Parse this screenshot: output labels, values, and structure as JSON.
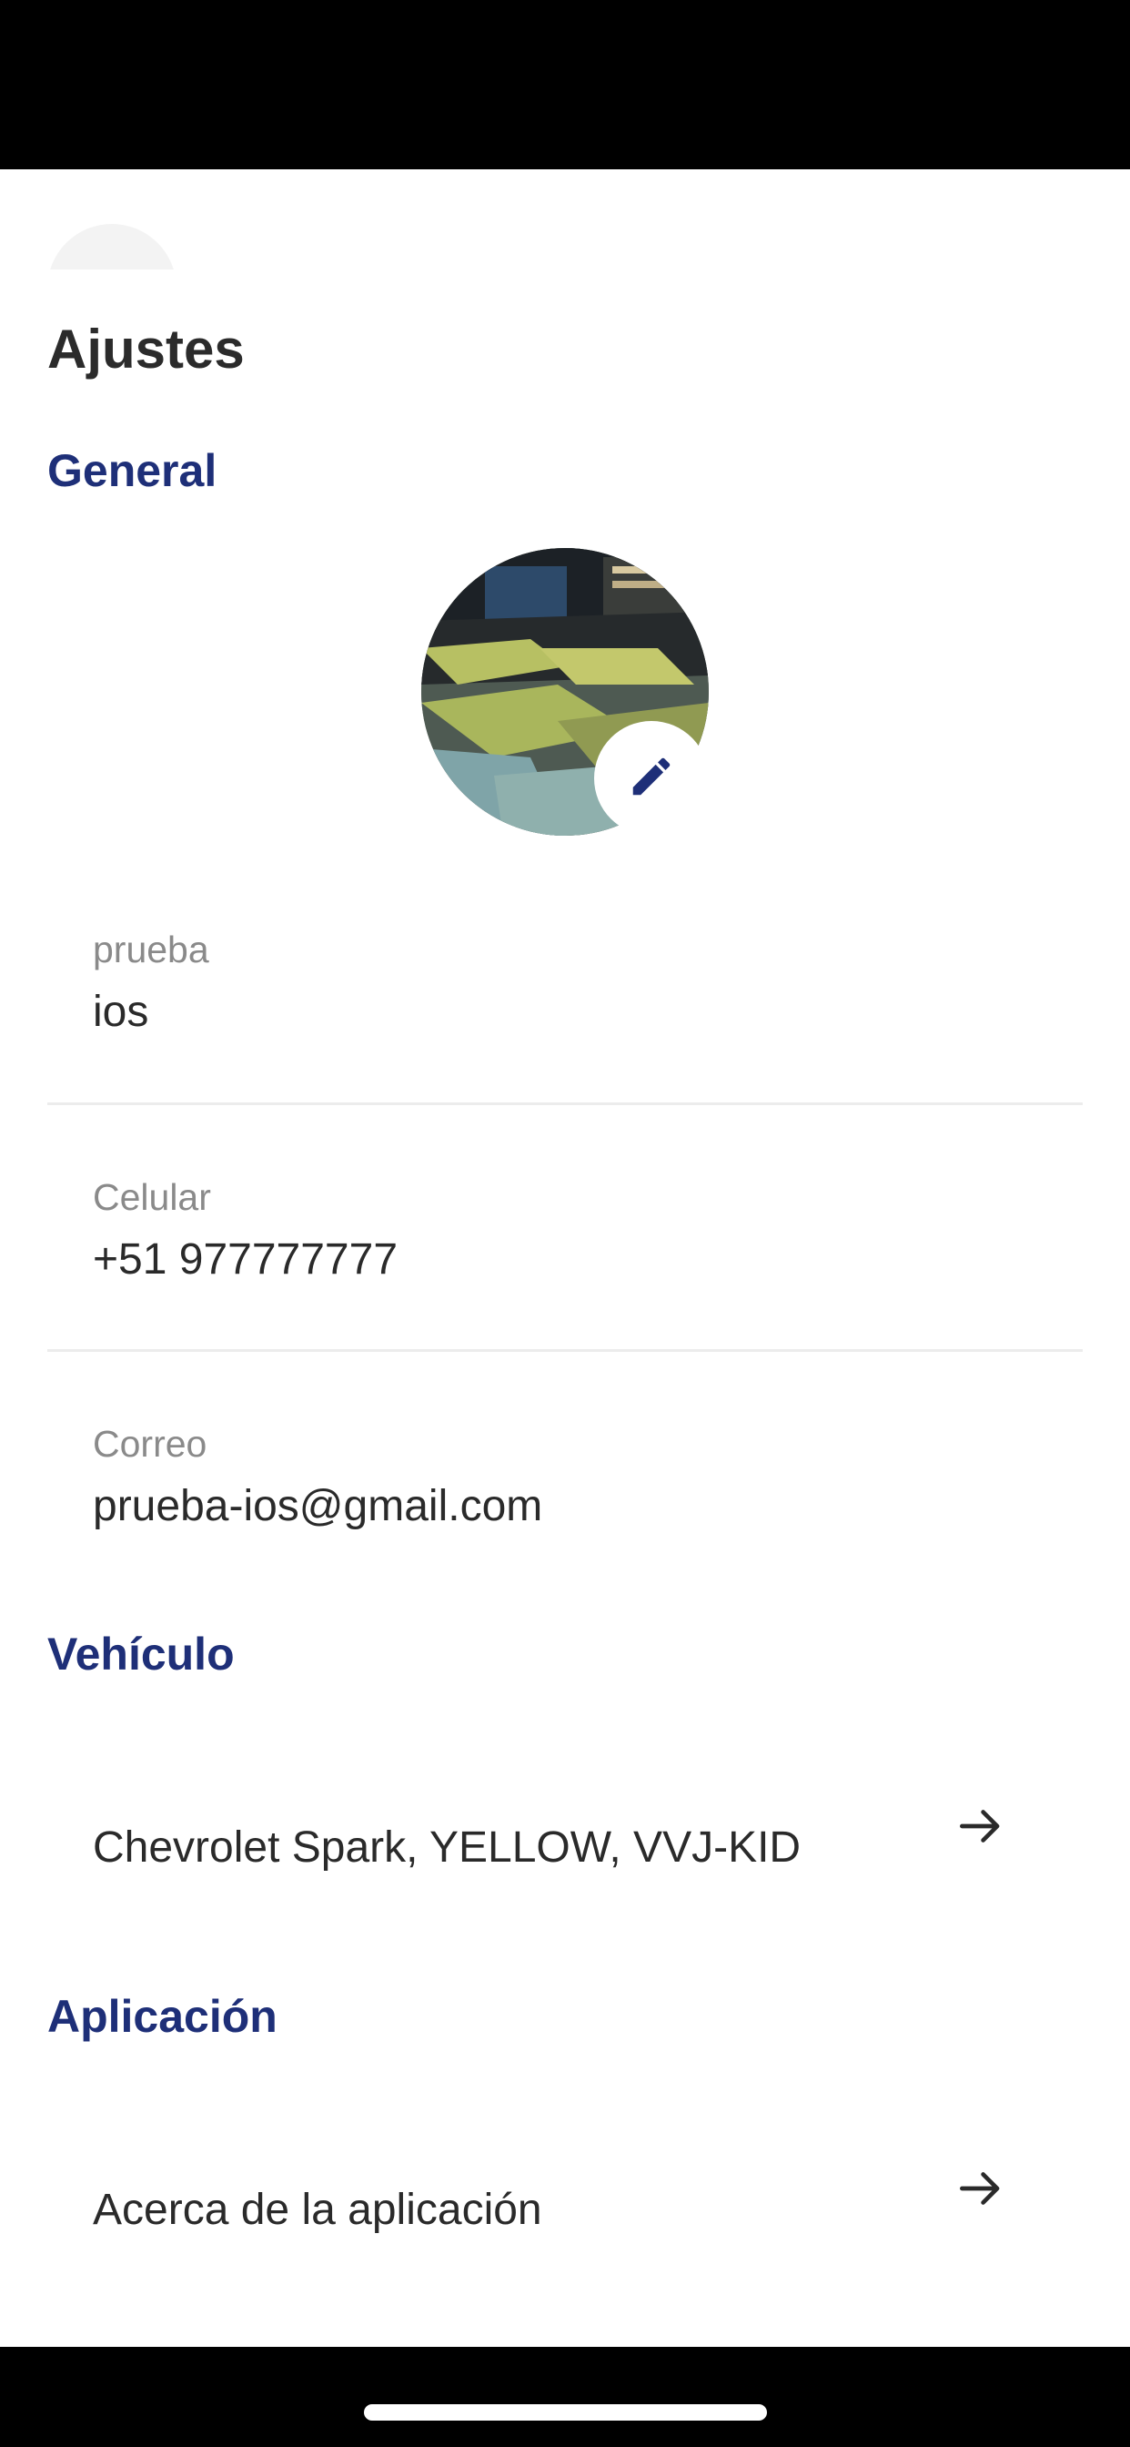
{
  "header": {
    "title": "Ajustes"
  },
  "sections": {
    "general": "General",
    "vehicle": "Vehículo",
    "application": "Aplicación"
  },
  "profile": {
    "name_label": "prueba",
    "name_value": "ios",
    "phone_label": "Celular",
    "phone_value": "+51 977777777",
    "email_label": "Correo",
    "email_value": "prueba-ios@gmail.com"
  },
  "vehicle": {
    "description": "Chevrolet Spark, YELLOW, VVJ-KID"
  },
  "application": {
    "about_label": "Acerca de la aplicación"
  },
  "icons": {
    "back": "chevron-left-icon",
    "edit": "pencil-icon",
    "arrow": "arrow-right-icon"
  },
  "colors": {
    "accent": "#1e2f78",
    "title": "#2b2b2b",
    "label": "#8a8a8a"
  }
}
